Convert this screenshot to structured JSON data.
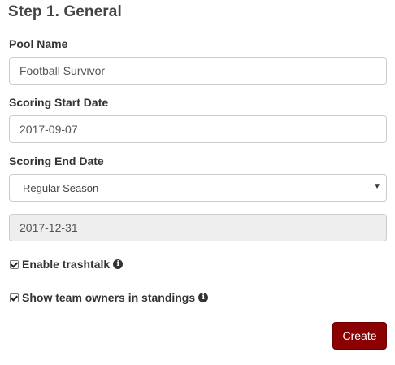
{
  "step": {
    "title": "Step 1. General"
  },
  "form": {
    "pool_name": {
      "label": "Pool Name",
      "value": "Football Survivor"
    },
    "scoring_start": {
      "label": "Scoring Start Date",
      "value": "2017-09-07"
    },
    "scoring_end": {
      "label": "Scoring End Date",
      "selected": "Regular Season",
      "date_value": "2017-12-31"
    },
    "checkboxes": [
      {
        "label": "Enable trashtalk",
        "checked": true,
        "icon": "info-icon"
      },
      {
        "label": "Show team owners in standings",
        "checked": true,
        "icon": "info-icon"
      }
    ],
    "submit_label": "Create"
  },
  "colors": {
    "primary_button": "#8b0000",
    "input_border": "#cccccc",
    "readonly_bg": "#eeeeee"
  }
}
